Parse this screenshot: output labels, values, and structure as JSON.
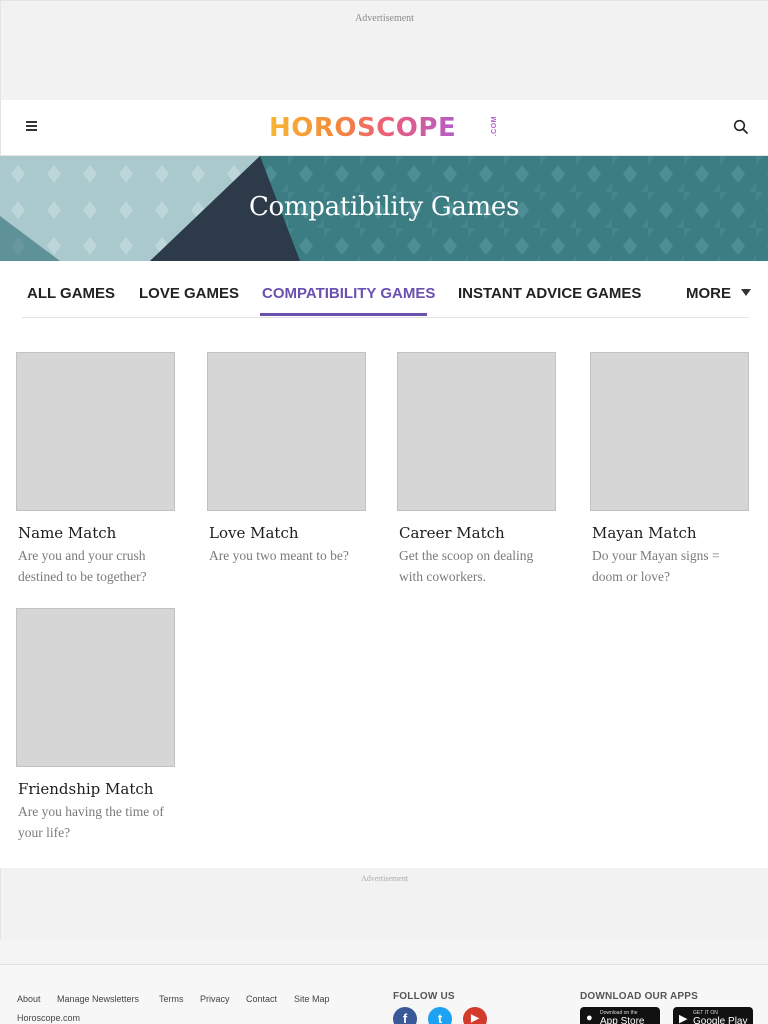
{
  "ads": {
    "top_label": "Advertisement",
    "bottom_label": "Advertisement"
  },
  "header": {
    "menu_icon": "hamburger-menu-icon",
    "logo_text": "HOROSCOPE",
    "logo_suffix": ".COM",
    "search_icon": "search-icon"
  },
  "hero": {
    "title": "Compatibility Games",
    "colors": {
      "teal": "#3c7d84",
      "dark": "#2c3a4a",
      "light": "#9ebfc4"
    }
  },
  "tabs": {
    "items": [
      {
        "label": "ALL GAMES",
        "active": false
      },
      {
        "label": "LOVE GAMES",
        "active": false
      },
      {
        "label": "COMPATIBILITY GAMES",
        "active": true
      },
      {
        "label": "INSTANT ADVICE GAMES",
        "active": false
      }
    ],
    "more_label": "MORE",
    "accent": "#6b50b0"
  },
  "games": [
    {
      "title": "Name Match",
      "description": "Are you and your crush destined to be together?"
    },
    {
      "title": "Love Match",
      "description": "Are you two meant to be?"
    },
    {
      "title": "Career Match",
      "description": "Get the scoop on dealing with coworkers."
    },
    {
      "title": "Mayan Match",
      "description": "Do your Mayan signs = doom or love?"
    },
    {
      "title": "Friendship Match",
      "description": "Are you having the time of your life?"
    }
  ],
  "footer": {
    "links": [
      "About",
      "Manage Newsletters",
      "Terms",
      "Privacy",
      "Contact",
      "Site Map"
    ],
    "site_name": "Horoscope.com",
    "follow_label": "FOLLOW US",
    "social": [
      {
        "icon": "facebook-icon",
        "glyph": "f",
        "color": "#3b5998"
      },
      {
        "icon": "twitter-icon",
        "glyph": "t",
        "color": "#1da1f2"
      },
      {
        "icon": "youtube-icon",
        "glyph": "▶",
        "color": "#d33a2c"
      }
    ],
    "apps_label": "DOWNLOAD OUR APPS",
    "stores": [
      {
        "small": "Download on the",
        "big": "App Store",
        "icon": "apple-icon"
      },
      {
        "small": "GET IT ON",
        "big": "Google Play",
        "icon": "google-play-icon"
      }
    ]
  }
}
